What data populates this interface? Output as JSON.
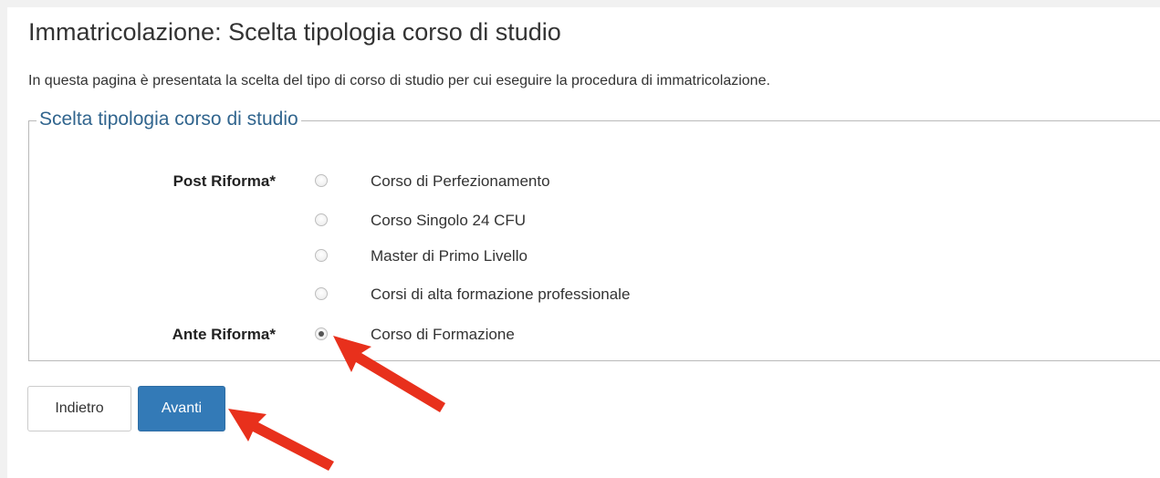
{
  "page": {
    "title": "Immatricolazione: Scelta tipologia corso di studio",
    "intro": "In questa pagina è presentata la scelta del tipo di corso di studio per cui eseguire la procedura di immatricolazione."
  },
  "form": {
    "legend": "Scelta tipologia corso di studio",
    "groups": [
      {
        "label": "Post Riforma*",
        "options": [
          {
            "label": "Corso di Perfezionamento",
            "checked": false
          },
          {
            "label": "Corso Singolo 24 CFU",
            "checked": false
          },
          {
            "label": "Master di Primo Livello",
            "checked": false
          },
          {
            "label": "Corsi di alta formazione professionale",
            "checked": false
          }
        ]
      },
      {
        "label": "Ante Riforma*",
        "options": [
          {
            "label": "Corso di Formazione",
            "checked": true
          }
        ]
      }
    ]
  },
  "buttons": {
    "back_label": "Indietro",
    "next_label": "Avanti"
  },
  "colors": {
    "legend": "#31658e",
    "primary_button": "#337ab7",
    "annotation_arrow": "#e8301c"
  }
}
